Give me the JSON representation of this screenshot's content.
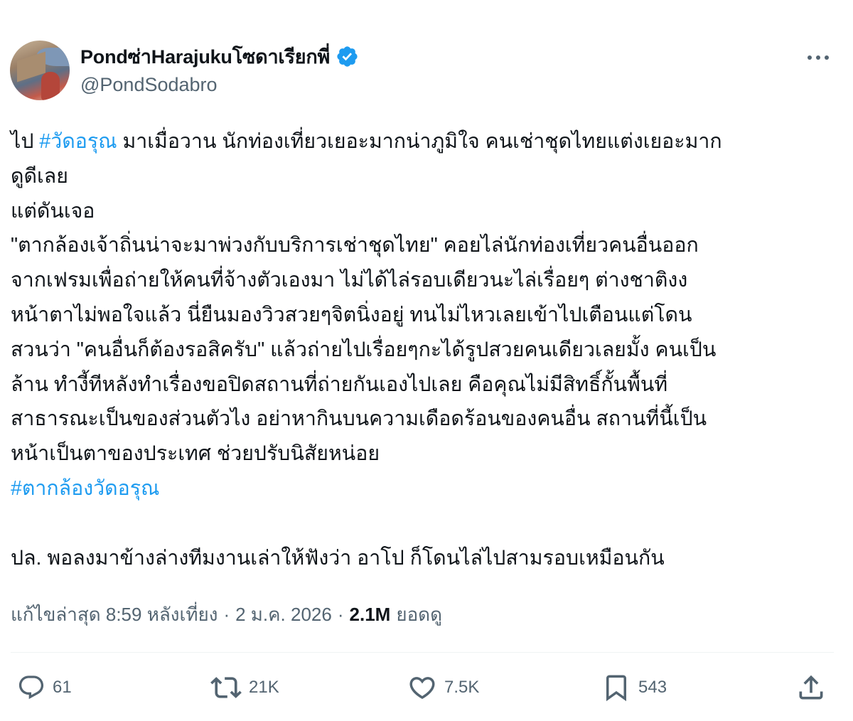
{
  "author": {
    "display_name": "Pondซ่าHarajukuโซดาเรียกพี่",
    "handle": "@PondSodabro",
    "verified": true,
    "avatar_icon": "profile-photo"
  },
  "tweet": {
    "lines": [
      [
        {
          "t": "ไป "
        },
        {
          "t": "#วัดอรุณ",
          "tag": true
        },
        {
          "t": " มาเมื่อวาน นักท่องเที่ยวเยอะมากน่าภูมิใจ คนเช่าชุดไทยแต่งเยอะมาก"
        }
      ],
      [
        {
          "t": "ดูดีเลย"
        }
      ],
      [
        {
          "t": "แต่ดันเจอ"
        }
      ],
      [
        {
          "t": "\"ตากล้องเจ้าถิ่นน่าจะมาพ่วงกับบริการเช่าชุดไทย\" คอยไล่นักท่องเที่ยวคนอื่นออก"
        }
      ],
      [
        {
          "t": "จากเฟรมเพื่อถ่ายให้คนที่จ้างตัวเองมา ไม่ได้ไล่รอบเดียวนะไล่เรื่อยๆ ต่างชาติงง"
        }
      ],
      [
        {
          "t": "หน้าตาไม่พอใจแล้ว นี่ยืนมองวิวสวยๆจิตนิ่งอยู่ ทนไม่ไหวเลยเข้าไปเตือนแต่โดน"
        }
      ],
      [
        {
          "t": "สวนว่า \"คนอื่นก็ต้องรอสิครับ\" แล้วถ่ายไปเรื่อยๆกะได้รูปสวยคนเดียวเลยมั้ง คนเป็น"
        }
      ],
      [
        {
          "t": "ล้าน ทำงี้ทีหลังทำเรื่องขอปิดสถานที่ถ่ายกันเองไปเลย คือคุณไม่มีสิทธิ์กั้นพื้นที่"
        }
      ],
      [
        {
          "t": "สาธารณะเป็นของส่วนตัวไง อย่าหากินบนความเดือดร้อนของคนอื่น สถานที่นี้เป็น"
        }
      ],
      [
        {
          "t": "หน้าเป็นตาของประเทศ ช่วยปรับนิสัยหน่อย"
        }
      ],
      [
        {
          "t": "#ตากล้องวัดอรุณ",
          "tag": true
        }
      ],
      [
        {
          "t": ""
        }
      ],
      [
        {
          "t": "ปล. พอลงมาข้างล่างทีมงานเล่าให้ฟังว่า อาโป ก็โดนไล่ไปสามรอบเหมือนกัน"
        }
      ]
    ],
    "edited_label": "แก้ไขล่าสุด",
    "time": "8:59 หลังเที่ยง",
    "separator": "·",
    "date": "2 ม.ค. 2026",
    "views_count": "2.1M",
    "views_label": "ยอดดู"
  },
  "actions": {
    "replies": "61",
    "reposts": "21K",
    "likes": "7.5K",
    "bookmarks": "543"
  },
  "colors": {
    "accent": "#1d9bf0",
    "text": "#0f1419",
    "muted": "#536471",
    "divider": "#eff3f4"
  }
}
